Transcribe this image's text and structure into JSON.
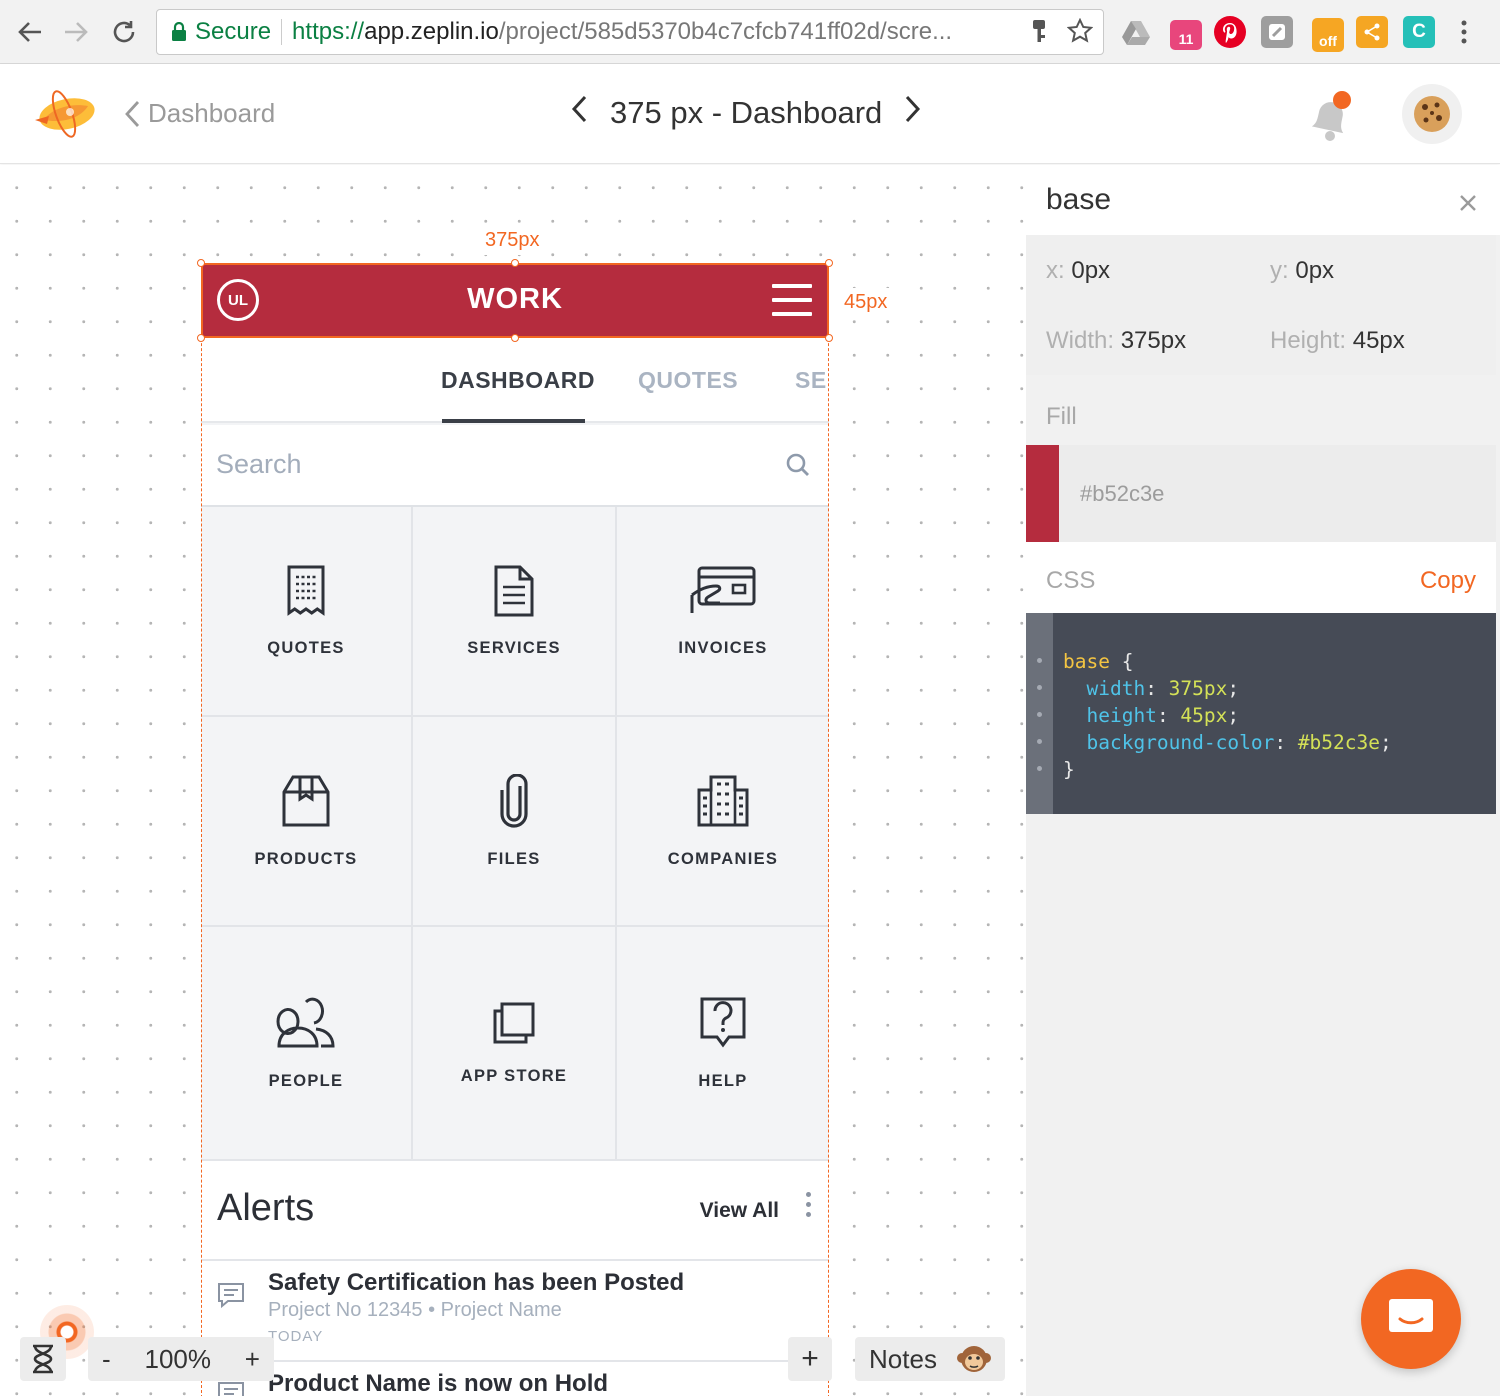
{
  "browser": {
    "secure_label": "Secure",
    "url_proto": "https://",
    "url_host": "app.zeplin.io",
    "url_path": "/project/585d5370b4c7cfcb741ff02d/scre...",
    "ext_badge_11": "11",
    "ext_badge_off": "off",
    "ext_c": "C"
  },
  "header": {
    "back_label": "Dashboard",
    "screen_title": "375 px - Dashboard"
  },
  "canvas": {
    "width_label": "375px",
    "height_label": "45px",
    "zoom": "100%",
    "zoom_minus": "-",
    "zoom_plus": "+",
    "add_label": "+",
    "notes_label": "Notes"
  },
  "app": {
    "logo_text": "UL",
    "title": "WORK",
    "tabs": [
      "DASHBOARD",
      "QUOTES",
      "SE"
    ],
    "search_placeholder": "Search",
    "tiles": [
      {
        "label": "QUOTES",
        "icon": "receipt-icon"
      },
      {
        "label": "SERVICES",
        "icon": "document-icon"
      },
      {
        "label": "INVOICES",
        "icon": "credit-card-icon"
      },
      {
        "label": "PRODUCTS",
        "icon": "box-icon"
      },
      {
        "label": "FILES",
        "icon": "paperclip-icon"
      },
      {
        "label": "COMPANIES",
        "icon": "building-icon"
      },
      {
        "label": "PEOPLE",
        "icon": "people-icon"
      },
      {
        "label": "APP STORE",
        "icon": "layers-icon"
      },
      {
        "label": "HELP",
        "icon": "help-icon"
      }
    ],
    "alerts_title": "Alerts",
    "view_all": "View All",
    "alerts": [
      {
        "title": "Safety Certification has been Posted",
        "sub": "Project No 12345 • Project Name",
        "time": "TODAY"
      },
      {
        "title": "Product Name is now on Hold"
      }
    ]
  },
  "inspector": {
    "layer_name": "base",
    "x_key": "x:",
    "x_val": "0px",
    "y_key": "y:",
    "y_val": "0px",
    "w_key": "Width:",
    "w_val": "375px",
    "h_key": "Height:",
    "h_val": "45px",
    "fill_label": "Fill",
    "fill_hex": "#b52c3e",
    "css_label": "CSS",
    "copy_label": "Copy",
    "code": {
      "selector": "base",
      "open": " {",
      "props": [
        {
          "name": "width",
          "value": "375px"
        },
        {
          "name": "height",
          "value": "45px"
        },
        {
          "name": "background-color",
          "value": "#b52c3e"
        }
      ],
      "close": "}"
    }
  },
  "colors": {
    "brand_red": "#b52c3e",
    "zeplin_orange": "#f26722"
  }
}
